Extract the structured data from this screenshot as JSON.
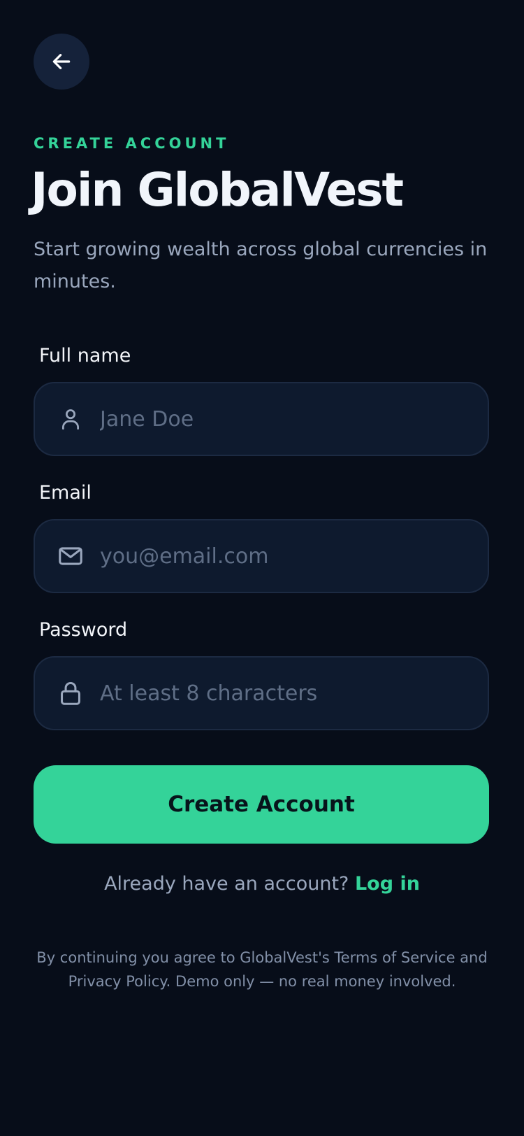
{
  "header": {
    "back_icon": "arrow-left-icon",
    "eyebrow": "CREATE ACCOUNT",
    "title": "Join GlobalVest",
    "subtitle": "Start growing wealth across global currencies in minutes."
  },
  "form": {
    "full_name": {
      "label": "Full name",
      "placeholder": "Jane Doe",
      "value": "",
      "icon": "user-icon"
    },
    "email": {
      "label": "Email",
      "placeholder": "you@email.com",
      "value": "",
      "icon": "mail-icon"
    },
    "password": {
      "label": "Password",
      "placeholder": "At least 8 characters",
      "value": "",
      "icon": "lock-icon"
    },
    "submit_label": "Create Account"
  },
  "footer": {
    "login_prompt": "Already have an account?",
    "login_link": "Log in",
    "disclaimer": "By continuing you agree to GlobalVest's Terms of Service and Privacy Policy. Demo only — no real money involved."
  },
  "colors": {
    "background": "#070d19",
    "accent": "#34d399",
    "field_background": "#0e1a2e",
    "field_border": "#1c2a42",
    "muted_text": "#9aa7bd"
  }
}
